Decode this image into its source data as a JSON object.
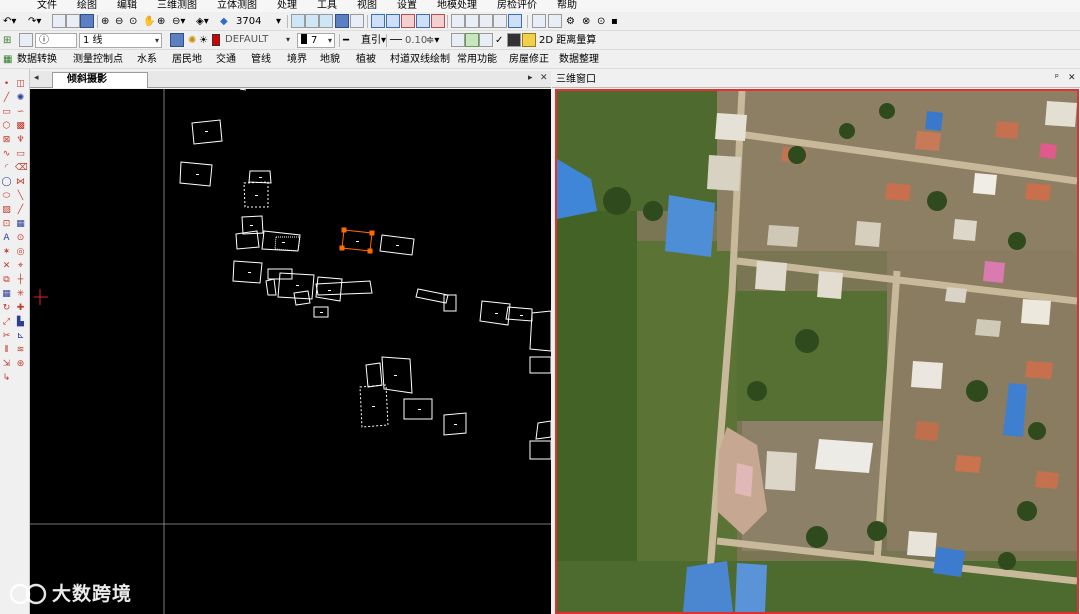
{
  "menubar": {
    "items": [
      "文件",
      "绘图",
      "编辑",
      "三维测图",
      "立体测图",
      "处理",
      "工具",
      "视图",
      "设置",
      "地模处理",
      "房检评价",
      "帮助"
    ]
  },
  "toolbar1": {
    "scale_value": "3704"
  },
  "toolbar2": {
    "layer_value": "1 线",
    "linetype_value": "DEFAULT",
    "color_index": "7",
    "style_label": "直引",
    "lineweight_value": "0.10",
    "distance_label": "2D 距离量算",
    "layer_color": "#d40000"
  },
  "toolbar3": {
    "items": [
      "数据转换",
      "测量控制点",
      "水系",
      "居民地",
      "交通",
      "管线",
      "境界",
      "地貌",
      "植被",
      "村道双线绘制",
      "常用功能",
      "房屋修正",
      "数据整理"
    ]
  },
  "cad_panel": {
    "tab_label": "倾斜摄影"
  },
  "three_panel": {
    "title": "三维窗口",
    "pin": "ᵖ",
    "close": "✕"
  },
  "watermark": {
    "text": "大数跨境"
  },
  "colors": {
    "cad_bg": "#000000",
    "selected": "#ff6a00",
    "frame": "#e03030"
  }
}
